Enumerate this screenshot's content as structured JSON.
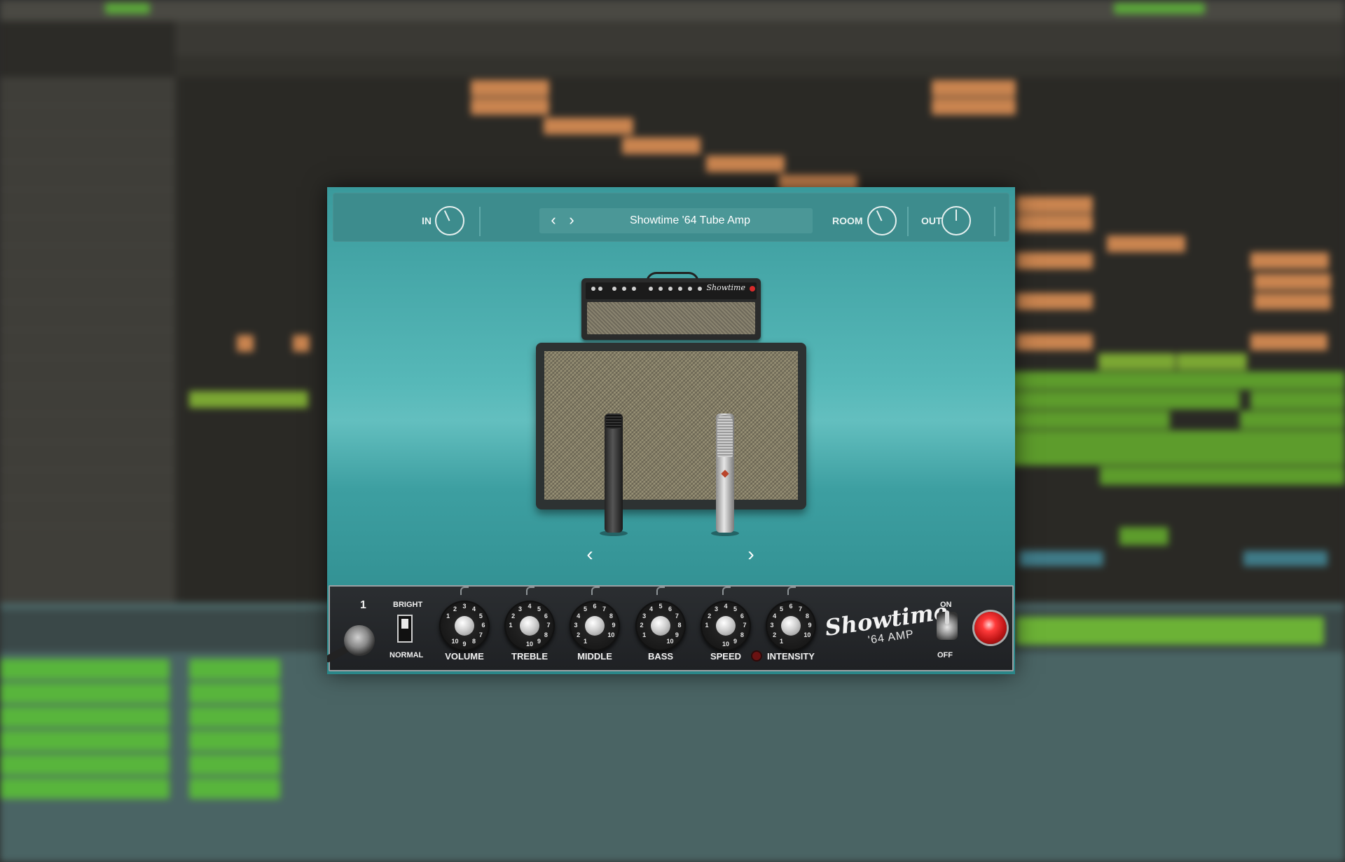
{
  "plugin": {
    "header": {
      "in_label": "IN",
      "preset_name": "Showtime '64 Tube Amp",
      "prev_preset": "‹",
      "next_preset": "›",
      "room_label": "ROOM",
      "out_label": "OUT"
    },
    "amp": {
      "head_logo": "Showtime"
    },
    "mic_nav": {
      "prev": "‹",
      "next": "›"
    },
    "controls": {
      "channel_number": "1",
      "bright_label": "BRIGHT",
      "normal_label": "NORMAL",
      "knobs": [
        {
          "label": "VOLUME",
          "value": 3
        },
        {
          "label": "TREBLE",
          "value": 4
        },
        {
          "label": "MIDDLE",
          "value": 6
        },
        {
          "label": "BASS",
          "value": 5
        },
        {
          "label": "SPEED",
          "value": 4
        },
        {
          "label": "INTENSITY",
          "value": 6
        }
      ],
      "brand_name": "Showtime",
      "brand_sub": "'64 AMP",
      "on_label": "ON",
      "off_label": "OFF"
    }
  },
  "colors": {
    "plugin_bg": "#56b8b8",
    "header_bg": "#3d8c8d",
    "control_panel": "#24272a",
    "power_jewel": "#ff3a3a",
    "clip_orange": "#c9844f",
    "clip_green": "#7ba733"
  },
  "icons": [
    "chevron-left-icon",
    "chevron-right-icon"
  ]
}
